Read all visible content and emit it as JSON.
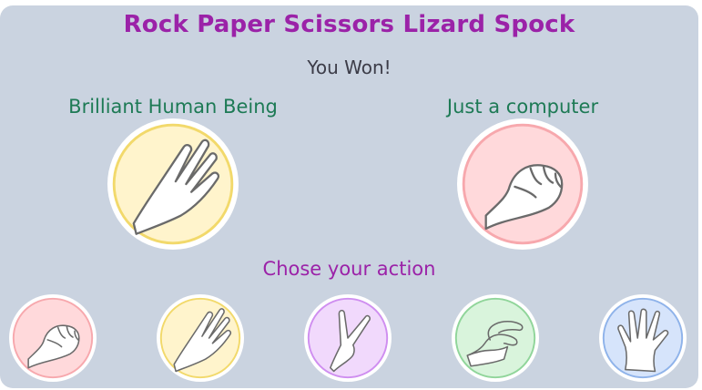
{
  "game": {
    "title": "Rock Paper Scissors Lizard Spock",
    "result": "You Won!",
    "prompt": "Chose your action"
  },
  "players": {
    "human": {
      "label": "Brilliant Human Being",
      "choice": "paper"
    },
    "computer": {
      "label": "Just a computer",
      "choice": "rock"
    }
  },
  "actions": [
    {
      "id": "rock",
      "icon": "rock-hand-icon",
      "color": "#f7a8ad",
      "fill": "#ffd9db"
    },
    {
      "id": "paper",
      "icon": "paper-hand-icon",
      "color": "#f2d96b",
      "fill": "#fff4cc"
    },
    {
      "id": "scissors",
      "icon": "scissors-hand-icon",
      "color": "#cf8ef0",
      "fill": "#f1d9fc"
    },
    {
      "id": "lizard",
      "icon": "lizard-hand-icon",
      "color": "#90d59a",
      "fill": "#d9f4dc"
    },
    {
      "id": "spock",
      "icon": "spock-hand-icon",
      "color": "#8fb3ea",
      "fill": "#d6e4fb"
    }
  ],
  "colors": {
    "background": "#cad3e0",
    "title": "#9b22a8",
    "player_label": "#1d7a55"
  }
}
